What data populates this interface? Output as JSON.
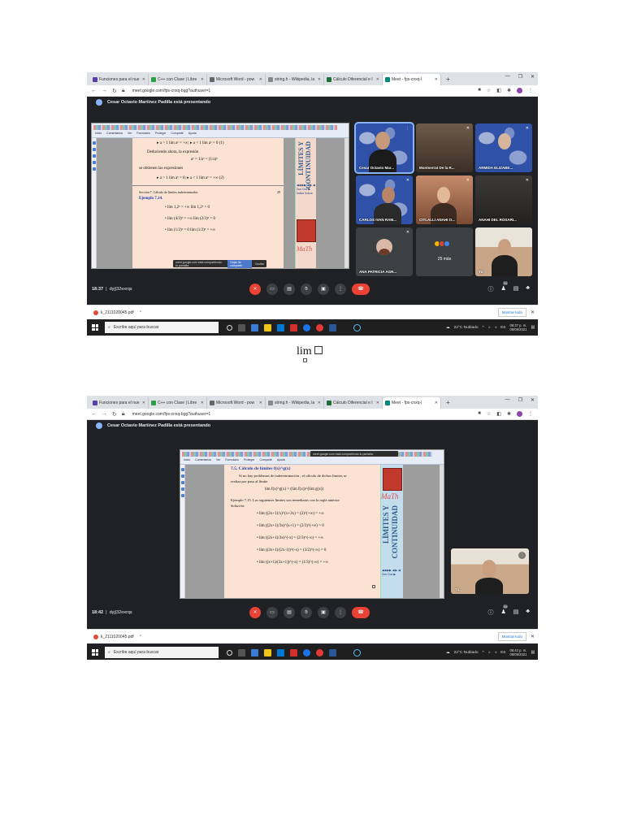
{
  "browser": {
    "tabs": [
      {
        "label": "Funciones para el nue",
        "color": "#5b3fa8"
      },
      {
        "label": "C++ con Clase | Libre",
        "color": "#2ea043"
      },
      {
        "label": "Microsoft Word - pow",
        "color": "#666666"
      },
      {
        "label": "string.h - Wikipedia, la",
        "color": "#888888"
      },
      {
        "label": "Cálculo Diferencial e I",
        "color": "#1e6e3a"
      },
      {
        "label": "Meet - fps-cnxq-l",
        "color": "#00897b"
      }
    ],
    "url": "meet.google.com/fps-cnxq-bgg?authuser=1",
    "presenting_text": "Cesar Octavio Martínez Padilla está presentando"
  },
  "shot1": {
    "ribbon_menu": [
      "Inicio",
      "Comentarios",
      "Ver",
      "Formulario",
      "Proteger",
      "Compartir",
      "Ayuda"
    ],
    "doc_lines": [
      "▸ a > 1   lím aˣ = +∞;    ▸ a < 1   lím aˣ = 0  (1)",
      "Deduciendo ahora, la expresión",
      "aˣ = 1/aˣ = (1/a)ˣ",
      "se obtienen las expresiones",
      "▸ a > 1   lím aˣ = 0;    ▸ a < 1   lím aˣ = +∞  (2)",
      "Sección 7. Cálculo de límites indeterminados",
      "Ejemplo 7.14.",
      "•  lím 1,2ˣ = +∞          lím 1,2ˣ = 0",
      "•  lím (4/3)ˣ = +∞        lím (2/3)ˣ = 0",
      "•  lím (1/2)ˣ = 0        lím (1/2)ˣ = +∞"
    ],
    "side_text_1": "LÍMITES Y",
    "side_text_2": "CONTINUIDAD",
    "side_nav": "◀◀ ▶▶   ◀ ▶   ◀ Doc Doc ▶   Índice Índice",
    "page_num": "29",
    "notif_text": "meet.google.com está compartiendo tu pantalla.",
    "notif_btn": "Dejar de compartir",
    "notif_hide": "Ocultar",
    "participants": [
      {
        "name": "Cesar Octavio Mar..."
      },
      {
        "name": "Montserrat De la R..."
      },
      {
        "name": "ARMIDA ELIZABE..."
      },
      {
        "name": "CARLOS IVAN RAM..."
      },
      {
        "name": "CITLALLI ANAHI O..."
      },
      {
        "name": "ANAHI DEL ROSARI..."
      },
      {
        "name": "ANA PATRICIA AGR..."
      },
      {
        "name": "25 más"
      },
      {
        "name": "Tú"
      }
    ],
    "time": "18:37",
    "code": "dyj|32exrqs",
    "people_count": "34"
  },
  "shot2": {
    "ribbon_menu": [
      "Inicio",
      "Comentarios",
      "Ver",
      "Formulario",
      "Proteger",
      "Compartir",
      "Ayuda"
    ],
    "doc_lines": [
      "7.5.  Cálculo de límites f(x)^g(x)",
      "Si no hay problemas de indeterminación , el cálculo de dichos límites se",
      "realiza por paso al límite",
      "lím f(x)^g(x) = (lím f(x))^(lím g(x))",
      "Ejemplo 7.15. Los siguientes límites son inmediatos con la regla anterior",
      "Solución:",
      "•  lím ((2x+1)/x)^(x+3x) = (2)^(+∞) = +∞",
      "•  lím ((2x+1)/3x)^(x+1) = (2/3)^(+∞) = 0",
      "•  lím ((2x+1)/3x)^(-x) = (2/3)^(-∞) = +∞",
      "•  lím ((3x+1)/(2x-1))^(-x) = (3/2)^(-∞) = 0",
      "•  lím ((x+1)/(3x+1))^(-x) = (1/3)^(-∞) = +∞"
    ],
    "side_text_1": "LÍMITES Y",
    "side_text_2": "CONTINUIDAD",
    "side_nav": "◀◀ ▶▶   ◀ ▶   ◀ Doc Doc ▶",
    "notif_text": "meet.google.com está compartiendo tu pantalla.",
    "self_name": "Tú",
    "time": "18:42",
    "code": "dyj|32exrqs",
    "people_count": "34"
  },
  "downloads": {
    "file": "k_2111020045.pdf",
    "show_all": "Mostrar todo"
  },
  "taskbar": {
    "search": "Escribe aquí para buscar",
    "weather1": "22°C  Nublado",
    "weather2": "22°C  Nublado",
    "time1": "06:37 p. m.",
    "time2": "06:42 p. m.",
    "date": "06/09/2021"
  },
  "formula": {
    "text": "lim"
  }
}
